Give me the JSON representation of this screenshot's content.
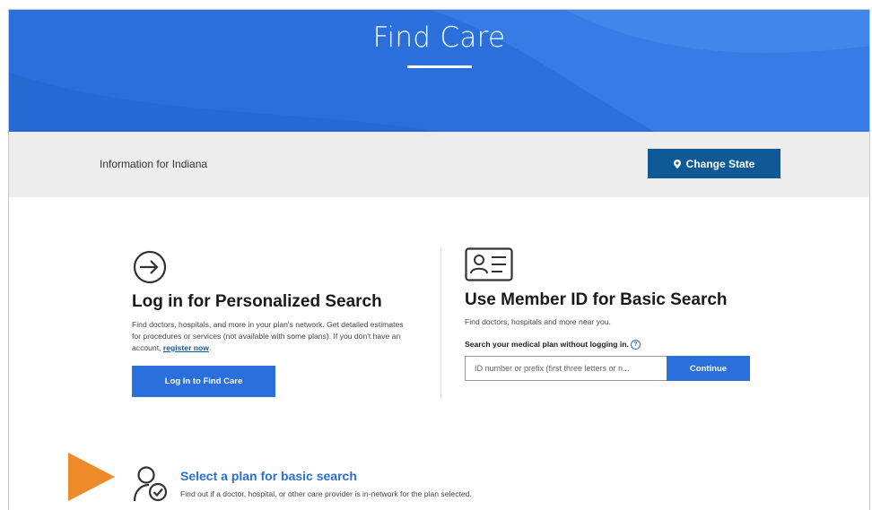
{
  "colors": {
    "brand_blue": "#2a6fdb",
    "dark_blue": "#0f5a96",
    "state_bar_gray": "#ededed",
    "marker_orange": "#ee8a2a"
  },
  "hero": {
    "title": "Find Care"
  },
  "state_bar": {
    "info_text": "Information for Indiana",
    "change_state_label": "Change State",
    "icon": "location-pin-icon"
  },
  "login_section": {
    "icon": "sign-in-arrow-icon",
    "heading": "Log in for Personalized Search",
    "description": "Find doctors, hospitals, and more in your plan's network. Get detailed estimates for procedures or services (not available with some plans). If you don't have an account,",
    "register_link": "register now",
    "button_label": "Log In to Find Care"
  },
  "member_id_section": {
    "icon": "id-card-icon",
    "heading": "Use Member ID for Basic Search",
    "description": "Find doctors, hospitals and more near you.",
    "search_label": "Search your medical plan without logging in.",
    "input_placeholder": "ID number or prefix (first three letters or n...",
    "continue_label": "Continue"
  },
  "plan_section": {
    "icon": "user-check-icon",
    "title": "Select a plan for basic search",
    "description": "Find out if a doctor, hospital, or other care provider is in-network for the plan selected."
  }
}
